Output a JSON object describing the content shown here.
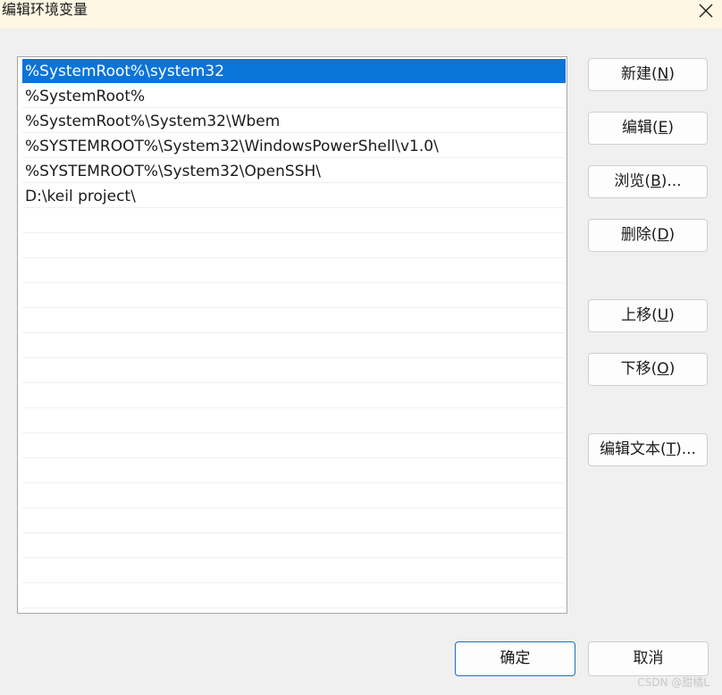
{
  "window": {
    "title": "编辑环境变量"
  },
  "path_list": {
    "items": [
      "%SystemRoot%\\system32",
      "%SystemRoot%",
      "%SystemRoot%\\System32\\Wbem",
      "%SYSTEMROOT%\\System32\\WindowsPowerShell\\v1.0\\",
      "%SYSTEMROOT%\\System32\\OpenSSH\\",
      "D:\\keil project\\"
    ],
    "selected_index": 0,
    "empty_rows": 16
  },
  "buttons": {
    "new": {
      "text": "新建(",
      "key": "N",
      "suffix": ")"
    },
    "edit": {
      "text": "编辑(",
      "key": "E",
      "suffix": ")"
    },
    "browse": {
      "text": "浏览(",
      "key": "B",
      "suffix": ")..."
    },
    "delete": {
      "text": "删除(",
      "key": "D",
      "suffix": ")"
    },
    "move_up": {
      "text": "上移(",
      "key": "U",
      "suffix": ")"
    },
    "move_down": {
      "text": "下移(",
      "key": "O",
      "suffix": ")"
    },
    "edit_text": {
      "text": "编辑文本(",
      "key": "T",
      "suffix": ")..."
    }
  },
  "footer": {
    "ok_label": "确定",
    "cancel_label": "取消"
  },
  "watermark": "CSDN @甜橘L",
  "colors": {
    "selection": "#0a74d9",
    "title_bar": "#fdf7e3",
    "default_button_border": "#1f6fbd"
  }
}
